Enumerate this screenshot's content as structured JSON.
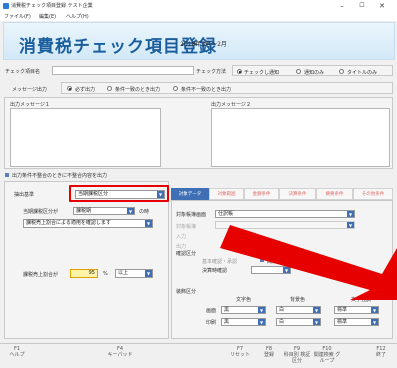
{
  "window": {
    "title": "消費税チェック項目登録 テスト企業",
    "min": "–",
    "max": "☐",
    "close": "✕"
  },
  "menu": [
    "ファイル(F)",
    "編集(E)",
    "ヘルプ(H)"
  ],
  "header": {
    "title": "消費税チェック項目登録",
    "period": "2018年3月～2月"
  },
  "form": {
    "check_name_label": "チェック項目名",
    "check_method_label": "チェック方法",
    "check_method_options": [
      "チェックし通知",
      "通知のみ",
      "タイトルのみ"
    ],
    "msg_output_label": "メッセージ出力",
    "msg_output_options": [
      "必ず出力",
      "条件一致のとき出力",
      "条件不一致のとき出力"
    ],
    "msg1_label": "出力メッセージ１",
    "msg2_label": "出力メッセージ２",
    "mismatch_label": "出力条件不整合のときに不整合内容を出力"
  },
  "lower": {
    "criteria_label": "抽出基準",
    "criteria_value": "当期課税区分",
    "cur_tax_label": "当期課税区分が",
    "cur_tax_value": "課税期",
    "cur_tax_suffix": "の時",
    "confirm_value": "課税売上割合による適用を確認します",
    "ratio_label": "課税売上割合が",
    "ratio_value": "95",
    "ratio_unit": "%",
    "ratio_cmp": "以上"
  },
  "tabs": [
    "対象データ",
    "対象範囲",
    "金額条件",
    "決算条件",
    "摘要条件",
    "その他条件"
  ],
  "right": {
    "screen_label": "対象帳簿画面",
    "screen_value": "仕訳帳",
    "faded1": "対象帳簿",
    "faded2": "入力",
    "faded3": "出力",
    "confirm_section": "確認区分",
    "base_confirm": "基本確認・承認",
    "no_problem": "問題なし",
    "settle_confirm": "決算時確認",
    "decor_section": "装飾区分",
    "col_char": "文字色",
    "col_bg": "背景色",
    "col_style": "文字強調",
    "row1_label": "画面",
    "row1_char": "黒",
    "row1_bg": "白",
    "row1_style": "標準",
    "row2_label": "印刷",
    "row2_char": "黒",
    "row2_bg": "白",
    "row2_style": "標準"
  },
  "fkeys": [
    {
      "key": "F1",
      "label": "ヘルプ"
    },
    {
      "key": "F4",
      "label": "キーパッド"
    },
    {
      "key": "F7",
      "label": "リセット"
    },
    {
      "key": "F8",
      "label": "登録"
    },
    {
      "key": "F9",
      "label": "科目別 検証区分"
    },
    {
      "key": "F10",
      "label": "関連検索 グループ"
    },
    {
      "key": "F12",
      "label": "終了"
    }
  ],
  "colors": {
    "accent": "#3f6fb5",
    "highlight": "#e60000",
    "banner_text": "#1a5e9e"
  }
}
